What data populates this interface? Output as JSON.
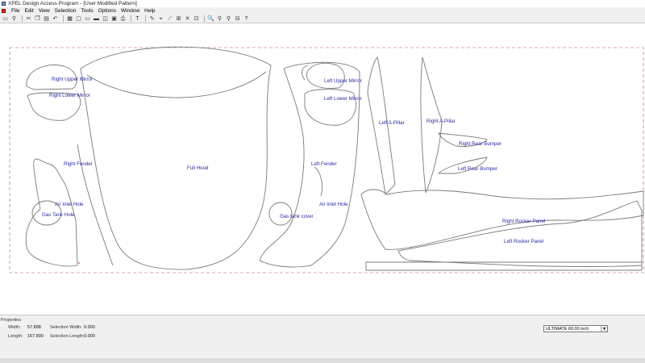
{
  "window": {
    "title": "XPEL Design Access Program - [User Modified Pattern]"
  },
  "menu": [
    "File",
    "Edit",
    "View",
    "Selection",
    "Tools",
    "Options",
    "Window",
    "Help"
  ],
  "toolbar_icons": [
    "new-icon",
    "search-icon",
    "cut-icon",
    "copy-icon",
    "paste-icon",
    "undo-icon",
    "grid-icon",
    "select-icon",
    "move-icon",
    "rotate-icon",
    "mirror-icon",
    "align-icon",
    "print-icon",
    "text-icon",
    "pen-icon",
    "node-icon",
    "cut-line-icon",
    "weld-icon",
    "trim-icon",
    "extend-icon",
    "zoom-in-icon",
    "zoom-out-icon",
    "zoom-fit-icon",
    "zoom-window-icon",
    "help-icon"
  ],
  "pattern_labels": {
    "right_upper_mirror": "Right Upper Mirror",
    "right_lower_mirror": "Right Lower Mirror",
    "right_fender": "Right Fender",
    "air_inlet_hole_right": "Air Inlet Hole",
    "gas_tank_hole": "Gas Tank Hole",
    "full_hood": "Full Hood",
    "left_upper_mirror": "Left Upper Mirror",
    "left_lower_mirror": "Left Lower Mirror",
    "left_fender": "Left Fender",
    "air_inlet_hole_left": "Air Inlet Hole",
    "gas_tank_cover": "Gas tank cover",
    "left_a_pillar": "Left A-Pillar",
    "right_a_pillar": "Right A-Pillar",
    "right_rear_bumper": "Right Rear Bumper",
    "left_rear_bumper": "Left Rear Bumper",
    "right_rocker_panel": "Right Rocker Panel",
    "left_rocker_panel": "Left Rocker Panel"
  },
  "properties": {
    "title": "Properties",
    "width_label": "Width:",
    "width_value": "57.888",
    "length_label": "Length:",
    "length_value": "167.800",
    "selection_width_label": "Selection Width:",
    "selection_width_value": "0.000",
    "selection_length_label": "Selection Length:",
    "selection_length_value": "0.000"
  },
  "film_select": {
    "value": "ULTIMATE  60.00 inch"
  },
  "colors": {
    "pattern_line": "#7a7a7a",
    "label_text": "#2a2aa0",
    "boundary": "#c05050"
  }
}
